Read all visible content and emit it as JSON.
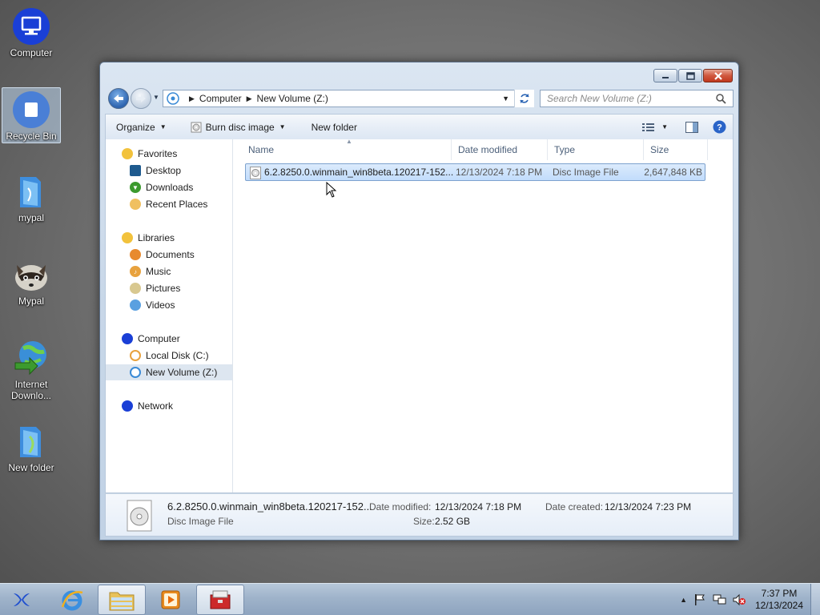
{
  "desktop": {
    "icons": [
      {
        "label": "Computer"
      },
      {
        "label": "Recycle Bin"
      },
      {
        "label": "mypal"
      },
      {
        "label": "Mypal"
      },
      {
        "label": "Internet Downlo..."
      },
      {
        "label": "New folder"
      }
    ]
  },
  "window": {
    "breadcrumb": [
      "Computer",
      "New Volume (Z:)"
    ],
    "search_placeholder": "Search New Volume (Z:)",
    "toolbar": {
      "organize": "Organize",
      "burn": "Burn disc image",
      "new_folder": "New folder"
    },
    "nav_pane": {
      "favorites": "Favorites",
      "favorites_items": [
        "Desktop",
        "Downloads",
        "Recent Places"
      ],
      "libraries": "Libraries",
      "libraries_items": [
        "Documents",
        "Music",
        "Pictures",
        "Videos"
      ],
      "computer": "Computer",
      "computer_items": [
        "Local Disk (C:)",
        "New Volume (Z:)"
      ],
      "network": "Network"
    },
    "columns": [
      "Name",
      "Date modified",
      "Type",
      "Size"
    ],
    "files": [
      {
        "name": "6.2.8250.0.winmain_win8beta.120217-152...",
        "date_modified": "12/13/2024 7:18 PM",
        "type": "Disc Image File",
        "size": "2,647,848 KB"
      }
    ],
    "details": {
      "name": "6.2.8250.0.winmain_win8beta.120217-152...",
      "type": "Disc Image File",
      "date_modified_label": "Date modified:",
      "date_modified": "12/13/2024 7:18 PM",
      "size_label": "Size:",
      "size": "2.52 GB",
      "date_created_label": "Date created:",
      "date_created": "12/13/2024 7:23 PM"
    }
  },
  "taskbar": {
    "time": "7:37 PM",
    "date": "12/13/2024"
  }
}
